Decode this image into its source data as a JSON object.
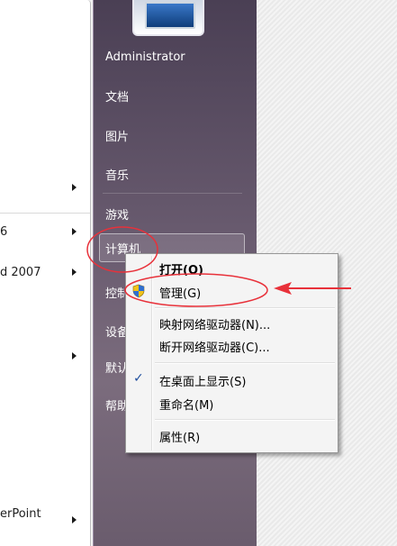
{
  "left_pane": {
    "items": [
      {
        "label": "6"
      },
      {
        "label": "d 2007"
      },
      {
        "label": "erPoint"
      }
    ]
  },
  "right_pane": {
    "items": [
      {
        "label": "Administrator"
      },
      {
        "label": "文档"
      },
      {
        "label": "图片"
      },
      {
        "label": "音乐"
      },
      {
        "label": "游戏"
      },
      {
        "label": "计算机"
      },
      {
        "label": "控制"
      },
      {
        "label": "设备"
      },
      {
        "label": "默认"
      },
      {
        "label": "帮助"
      }
    ]
  },
  "context_menu": {
    "items": [
      {
        "label": "打开(O)"
      },
      {
        "label": "管理(G)"
      },
      {
        "label": "映射网络驱动器(N)..."
      },
      {
        "label": "断开网络驱动器(C)..."
      },
      {
        "label": "在桌面上显示(S)"
      },
      {
        "label": "重命名(M)"
      },
      {
        "label": "属性(R)"
      }
    ]
  },
  "colors": {
    "annotation_red": "#e8313a",
    "pane_dark": "#5d5065",
    "menu_bg": "#f4f4f4"
  },
  "icons": [
    "shield-icon",
    "checkmark-icon",
    "computer-monitor-icon",
    "submenu-arrow-icon",
    "red-arrow-icon"
  ]
}
